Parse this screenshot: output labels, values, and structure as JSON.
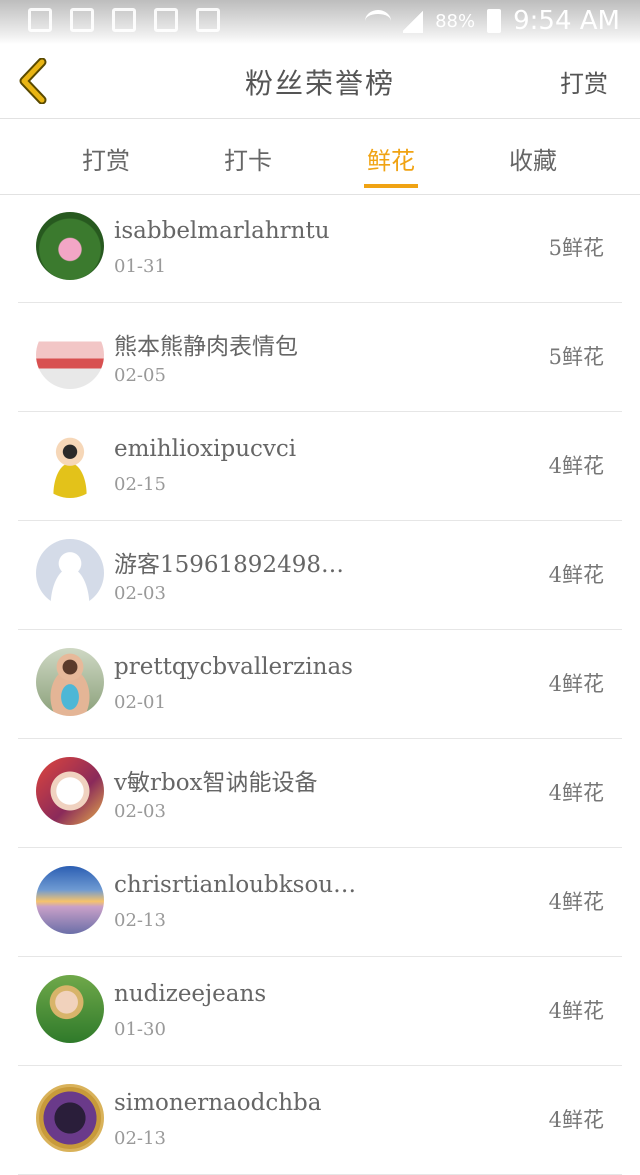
{
  "status_bar": {
    "battery": "88%",
    "time": "9:54 AM"
  },
  "header": {
    "back_icon": "chevron-left-icon",
    "title": "粉丝荣誉榜",
    "action_label": "打赏"
  },
  "tabs": [
    {
      "label": "打赏",
      "active": false
    },
    {
      "label": "打卡",
      "active": false
    },
    {
      "label": "鲜花",
      "active": true
    },
    {
      "label": "收藏",
      "active": false
    }
  ],
  "colors": {
    "accent": "#f0a313",
    "back_icon": "#e9b514"
  },
  "list": [
    {
      "name": "isabbelmarlahrntu",
      "date": "01-31",
      "count": "5鲜花",
      "avatar": "lotus-flower-photo"
    },
    {
      "name": "熊本熊静肉表情包",
      "date": "02-05",
      "count": "5鲜花",
      "avatar": "sticker-photo"
    },
    {
      "name": "emihlioxipucvci",
      "date": "02-15",
      "count": "4鲜花",
      "avatar": "cartoon-girl-photo"
    },
    {
      "name": "游客15961892498…",
      "date": "02-03",
      "count": "4鲜花",
      "avatar": "default-user-avatar"
    },
    {
      "name": "prettqycbvallerzinas",
      "date": "02-01",
      "count": "4鲜花",
      "avatar": "woman-photo"
    },
    {
      "name": "v敏rbox智讷能设备",
      "date": "02-03",
      "count": "4鲜花",
      "avatar": "cat-photo"
    },
    {
      "name": "chrisrtianloubksou…",
      "date": "02-13",
      "count": "4鲜花",
      "avatar": "sunset-sea-photo"
    },
    {
      "name": "nudizeejeans",
      "date": "01-30",
      "count": "4鲜花",
      "avatar": "child-on-grass-photo"
    },
    {
      "name": "simonernaodchba",
      "date": "02-13",
      "count": "4鲜花",
      "avatar": "dark-artwork-photo"
    }
  ]
}
